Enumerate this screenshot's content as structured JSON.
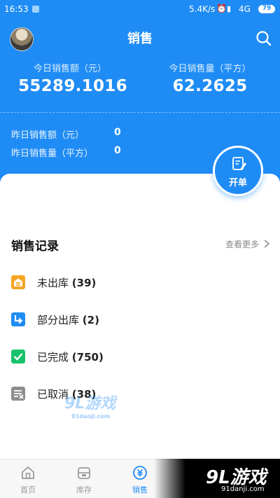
{
  "status_bar": {
    "time": "16:53",
    "speed": "5.4K/s",
    "signal": "4G",
    "battery": "79"
  },
  "header": {
    "title": "销售"
  },
  "today": {
    "amount_label": "今日销售额（元）",
    "amount_value": "55289.1016",
    "volume_label": "今日销售量（平方）",
    "volume_value": "62.2625"
  },
  "yesterday": {
    "amount_label": "昨日销售额（元）",
    "amount_value": "0",
    "volume_label": "昨日销售量（平方）",
    "volume_value": "0"
  },
  "fab": {
    "label": "开单"
  },
  "records": {
    "title": "销售记录",
    "see_more": "查看更多",
    "items": [
      {
        "label": "未出库",
        "count": "(39)",
        "color": "#f5a623"
      },
      {
        "label": "部分出库",
        "count": "(2)",
        "color": "#1f8cf5"
      },
      {
        "label": "已完成",
        "count": "(750)",
        "color": "#19c26b"
      },
      {
        "label": "已取消",
        "count": "(38)",
        "color": "#8e8e8e"
      }
    ]
  },
  "tabs": [
    {
      "label": "首页",
      "icon": "home-icon"
    },
    {
      "label": "库存",
      "icon": "inventory-icon"
    },
    {
      "label": "销售",
      "icon": "yen-icon"
    }
  ],
  "colors": {
    "primary": "#1f8cf5"
  },
  "watermark": {
    "main": "9L游戏",
    "sub": "91danji.com"
  }
}
